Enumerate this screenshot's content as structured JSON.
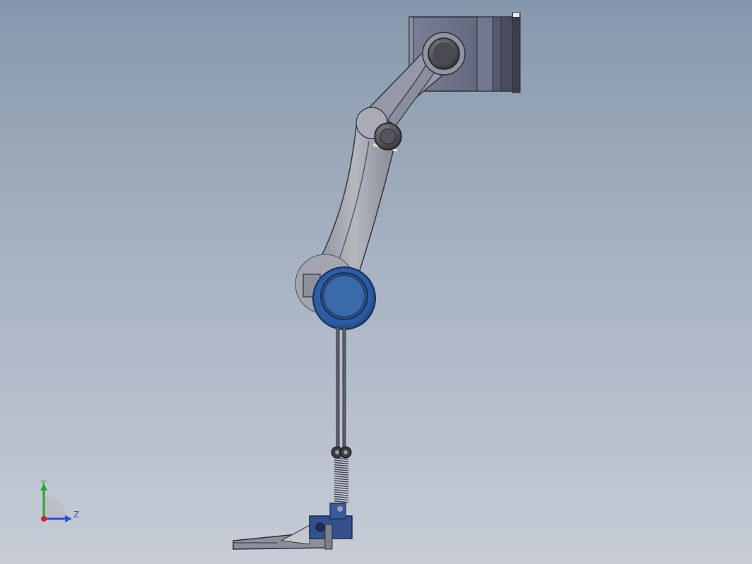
{
  "viewport": {
    "background_top": "#8797ab",
    "background_bottom": "#c7ccd6"
  },
  "triad": {
    "y_label": "Y",
    "z_label": "Z",
    "y_color": "#2aa52a",
    "z_color": "#2a4fd6",
    "x_color": "#d02020"
  },
  "model": {
    "description_icons": [
      "hip-bracket",
      "thigh-link",
      "knee-joint",
      "shank-rods",
      "ankle-spring",
      "foot-plate"
    ],
    "colors": {
      "bracket": "#6c7189",
      "link": "#9a9ca8",
      "knee_blue": "#2e62a8",
      "knee_face": "#3a6cae",
      "foot_blue": "#33508f",
      "dark": "#3a3a40"
    }
  }
}
